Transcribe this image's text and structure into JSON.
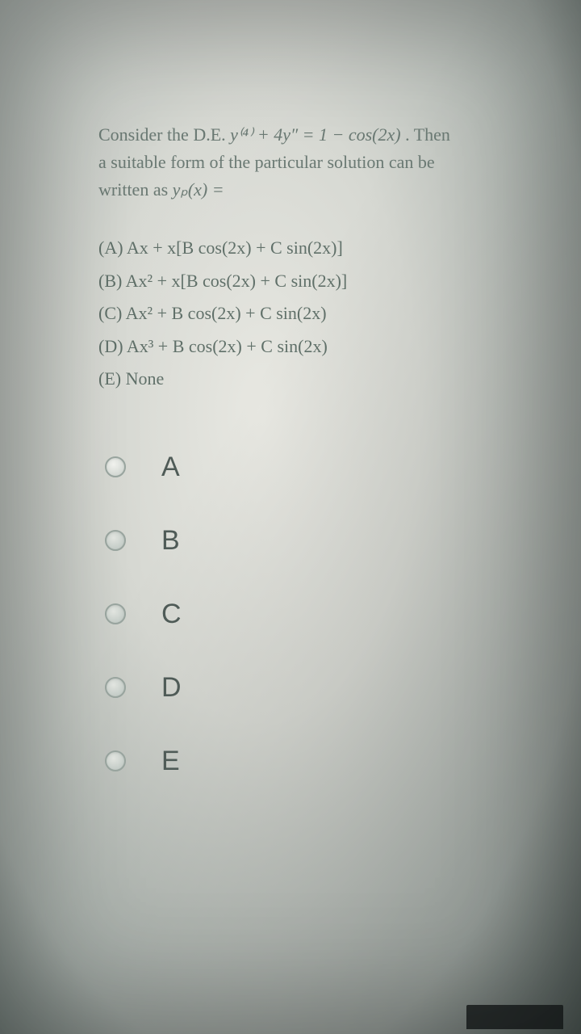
{
  "question": {
    "line1_pre": "Consider the D.E. ",
    "line1_eq": "y⁽⁴⁾ + 4y″ = 1 − cos(2x)",
    "line1_post": ". Then",
    "line2": "a suitable form of the particular solution can be",
    "line3_pre": "written as ",
    "line3_eq": "yₚ(x) ="
  },
  "choices_text": {
    "A": "(A)  Ax + x[B cos(2x) + C sin(2x)]",
    "B": "(B)  Ax² + x[B cos(2x) + C sin(2x)]",
    "C": "(C)  Ax² + B cos(2x) + C sin(2x)",
    "D": "(D)  Ax³ + B cos(2x) + C sin(2x)",
    "E": "(E)  None"
  },
  "radios": {
    "A": "A",
    "B": "B",
    "C": "C",
    "D": "D",
    "E": "E"
  }
}
